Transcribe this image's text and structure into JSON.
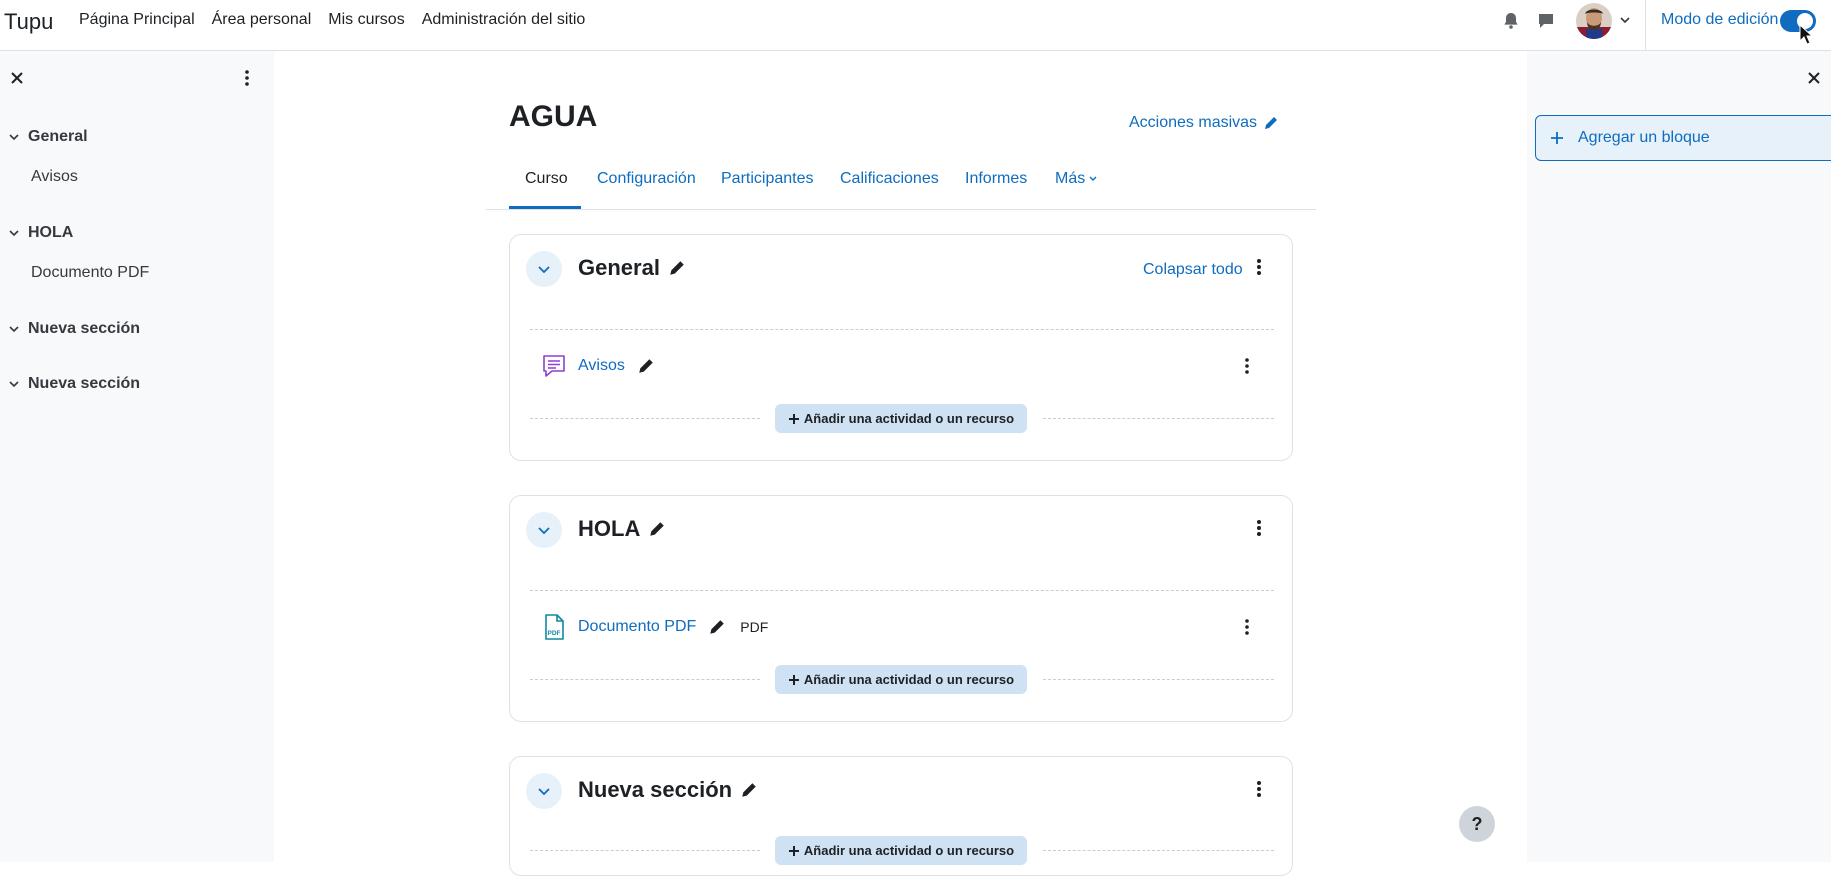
{
  "navbar": {
    "brand": "Tupu",
    "links": [
      "Página Principal",
      "Área personal",
      "Mis cursos",
      "Administración del sitio"
    ],
    "edit_mode_label": "Modo de edición",
    "edit_mode_on": true
  },
  "course_index": {
    "sections": [
      {
        "title": "General",
        "items": [
          "Avisos"
        ]
      },
      {
        "title": "HOLA",
        "items": [
          "Documento PDF"
        ]
      },
      {
        "title": "Nueva sección",
        "items": []
      },
      {
        "title": "Nueva sección",
        "items": []
      }
    ]
  },
  "course": {
    "title": "AGUA",
    "bulk_edit_label": "Acciones masivas",
    "tabs": [
      "Curso",
      "Configuración",
      "Participantes",
      "Calificaciones",
      "Informes",
      "Más"
    ],
    "active_tab": "Curso",
    "collapse_all_label": "Colapsar todo",
    "add_activity_label": "Añadir una actividad o un recurso",
    "sections": [
      {
        "title": "General",
        "activities": [
          {
            "name": "Avisos",
            "type": "forum",
            "badge": ""
          }
        ]
      },
      {
        "title": "HOLA",
        "activities": [
          {
            "name": "Documento PDF",
            "type": "pdf",
            "badge": "PDF"
          }
        ]
      },
      {
        "title": "Nueva sección",
        "activities": []
      }
    ]
  },
  "blocks": {
    "add_block_label": "Agregar un bloque"
  },
  "help_label": "?",
  "colors": {
    "primary": "#0f6cbf",
    "forum_icon": "#8f3fd1",
    "pdf_icon": "#0d8a9e",
    "drawer_bg": "#f8f9fa"
  }
}
